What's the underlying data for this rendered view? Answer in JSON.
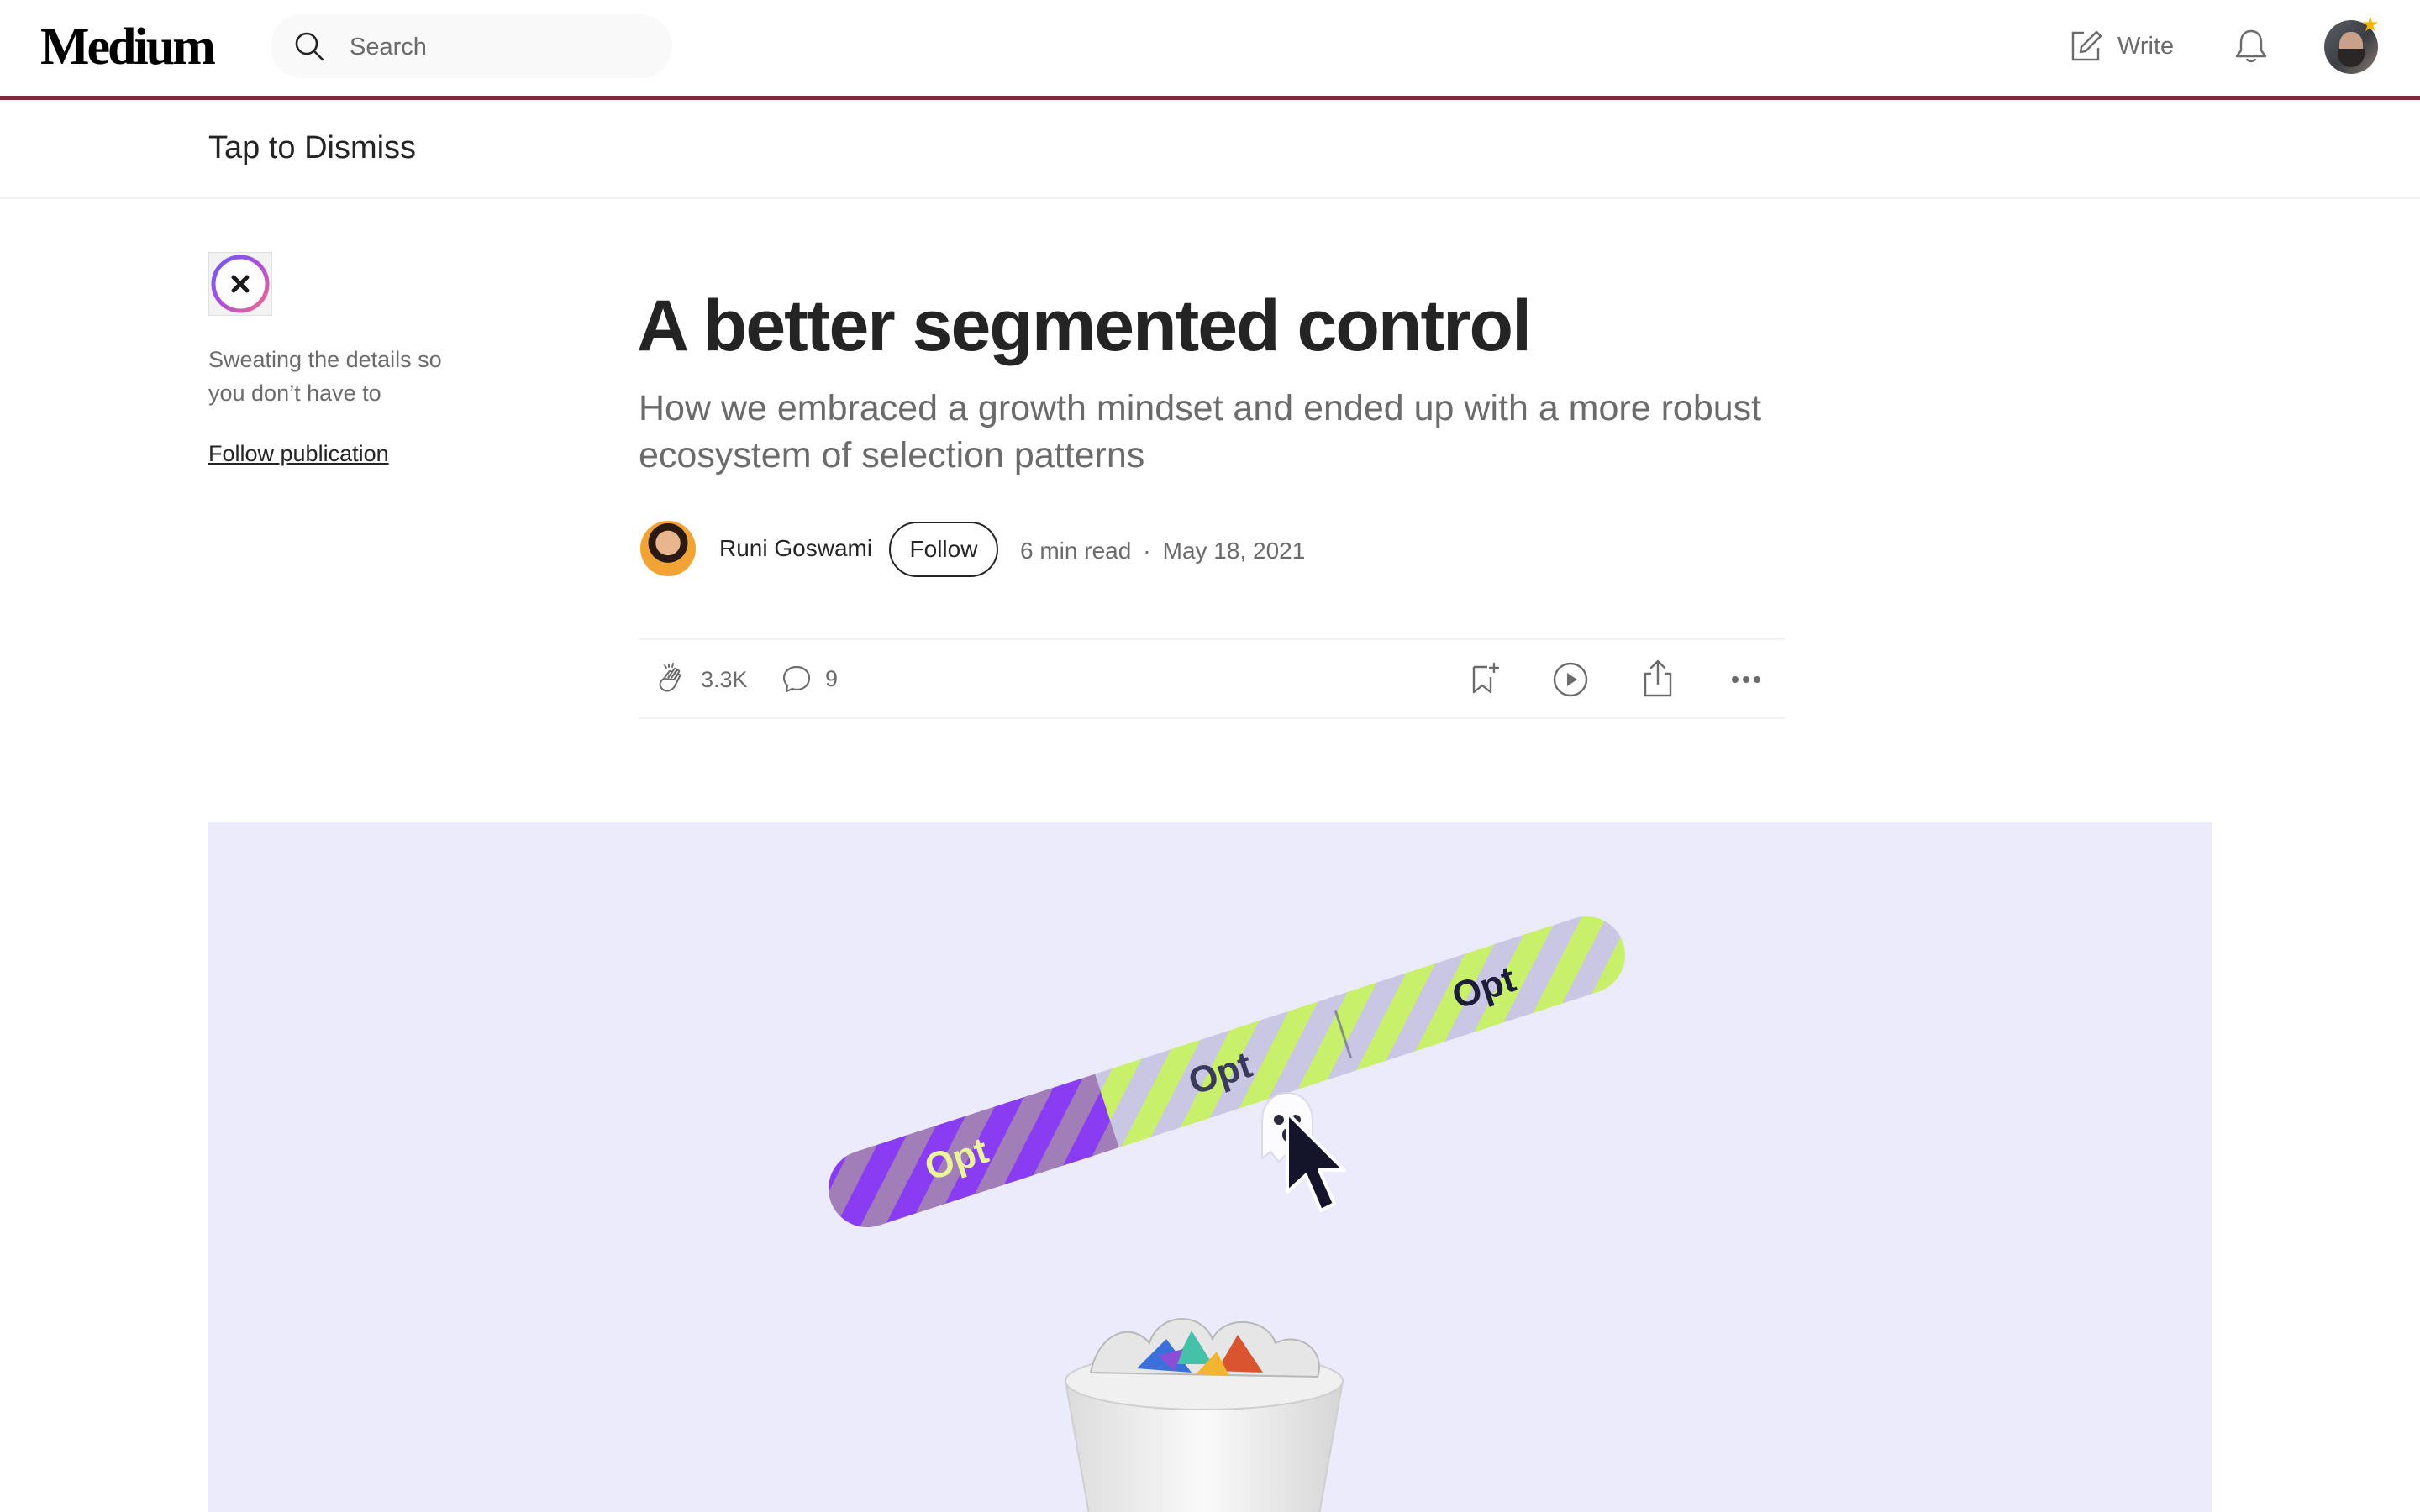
{
  "nav": {
    "logo": "Medium",
    "search_placeholder": "Search",
    "write_label": "Write"
  },
  "dismiss_bar": {
    "label": "Tap to Dismiss"
  },
  "publication": {
    "tagline": "Sweating the details so you don’t have to",
    "follow_label": "Follow publication"
  },
  "article": {
    "title": "A better segmented control",
    "subtitle": "How we embraced a growth mindset and ended up with a more robust ecosystem of selection patterns",
    "author": "Runi Goswami",
    "follow_label": "Follow",
    "read_time": "6 min read",
    "date": "May 18, 2021"
  },
  "actions": {
    "claps": "3.3K",
    "comments": "9"
  },
  "hero": {
    "segment_labels": [
      "Opt",
      "Opt",
      "Opt"
    ],
    "background_color": "#ebebfb",
    "selected_color": "#8a3cf2",
    "accent_color": "#c9f06a"
  },
  "icons": [
    "search-icon",
    "write-icon",
    "bell-icon",
    "avatar",
    "close-icon",
    "clap-icon",
    "comment-icon",
    "bookmark-icon",
    "play-icon",
    "share-icon",
    "more-icon",
    "cursor-icon",
    "ghost-icon",
    "trash-icon"
  ]
}
